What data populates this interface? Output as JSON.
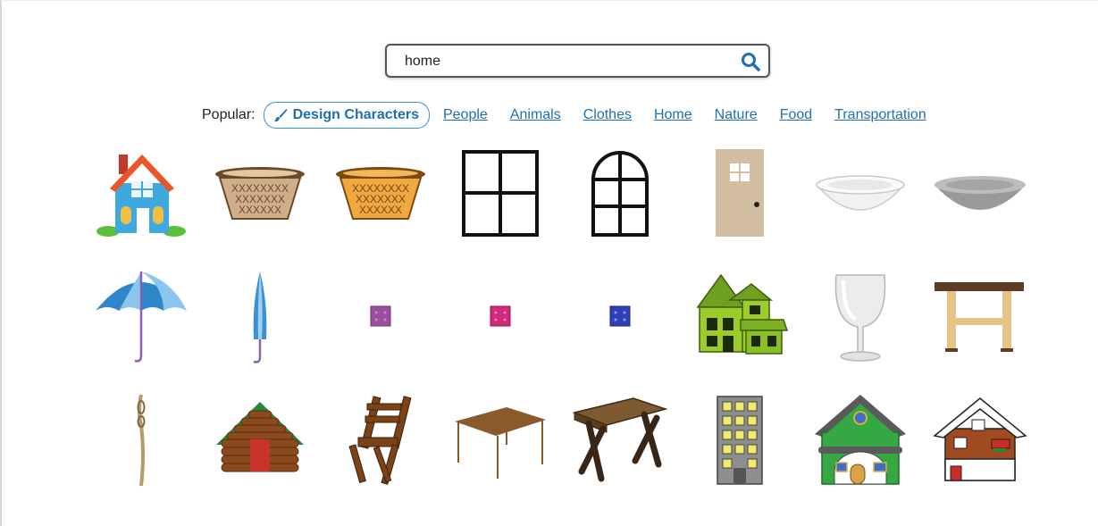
{
  "search": {
    "value": "home",
    "icon": "search-icon"
  },
  "popular": {
    "label": "Popular:",
    "featured": {
      "label": "Design Characters",
      "icon": "paintbrush-icon"
    },
    "links": [
      "People",
      "Animals",
      "Clothes",
      "Home",
      "Nature",
      "Food",
      "Transportation"
    ]
  },
  "colors": {
    "accent": "#1f6fb2",
    "pill_border": "#3a8fd0"
  },
  "results": [
    "house-icon",
    "wicker-basket-icon",
    "orange-basket-icon",
    "window-icon",
    "arched-window-icon",
    "door-icon",
    "white-bowl-icon",
    "gray-bowl-icon",
    "open-umbrella-icon",
    "closed-umbrella-icon",
    "purple-cushion-icon",
    "pink-cushion-icon",
    "blue-cushion-icon",
    "green-house-icon",
    "wine-glass-icon",
    "wooden-stool-icon",
    "rope-icon",
    "log-cabin-icon",
    "folding-chair-icon",
    "table-icon",
    "picnic-table-icon",
    "apartment-building-icon",
    "green-cottage-icon",
    "snowy-chalet-icon"
  ]
}
